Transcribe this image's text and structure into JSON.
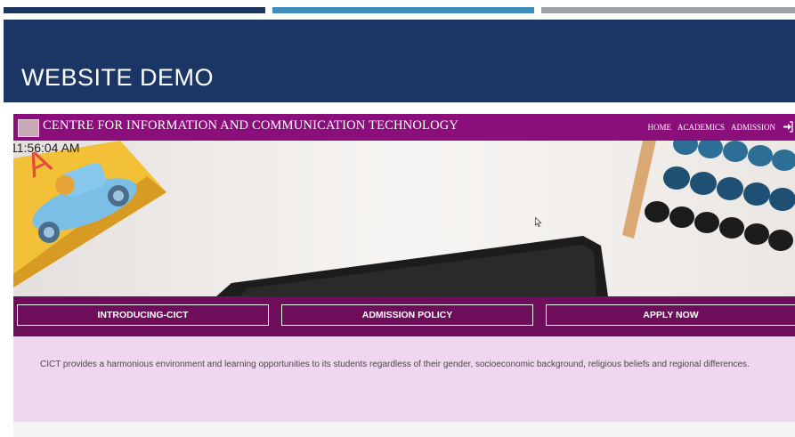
{
  "slide": {
    "title": "WEBSITE DEMO"
  },
  "site": {
    "brand": "CENTRE FOR INFORMATION AND COMMUNICATION TECHNOLOGY",
    "nav": [
      "HOME",
      "ACADEMICS",
      "ADMISSION"
    ],
    "login_icon": "sign-in-icon",
    "clock": "11:56:04 AM",
    "buttons": [
      "INTRODUCING-CICT",
      "ADMISSION POLICY",
      "APPLY NOW"
    ],
    "intro": "CICT provides a harmonious environment and learning opportunities to its students regardless of their gender, socioeconomic background, religious beliefs and regional differences."
  },
  "colors": {
    "accent_dark_blue": "#1d3461",
    "accent_light_blue": "#3e8dbd",
    "accent_gray": "#9ea3a8",
    "slide_header": "#1b3565",
    "navbar": "#8b0f7a",
    "button_bar": "#6e0e5a",
    "info_bg": "#efd7ef"
  }
}
